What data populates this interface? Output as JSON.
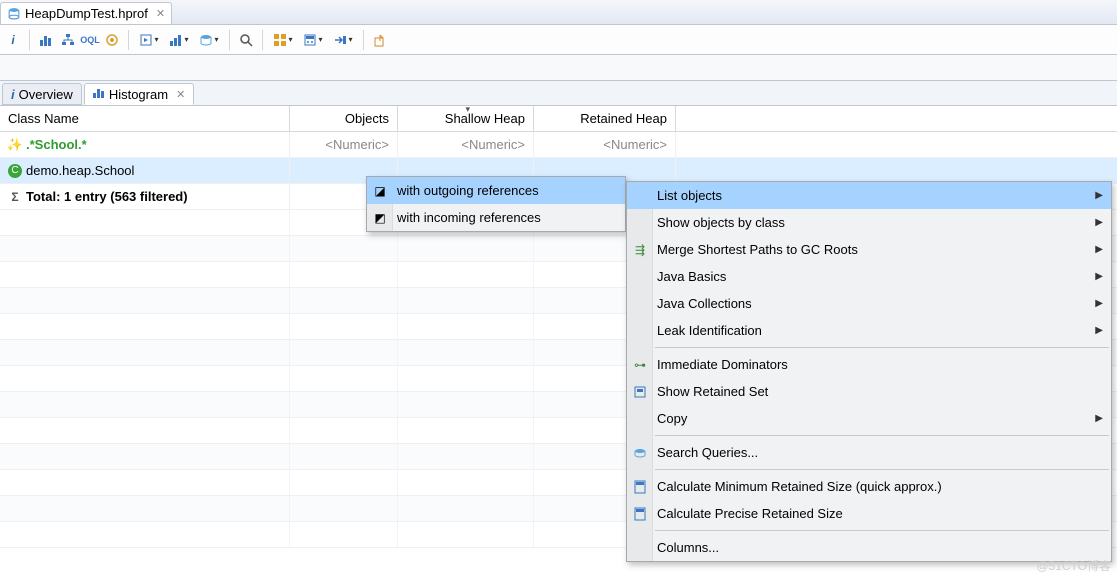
{
  "editorTab": {
    "title": "HeapDumpTest.hprof"
  },
  "viewTabs": {
    "overview": "Overview",
    "histogram": "Histogram"
  },
  "columns": {
    "className": "Class Name",
    "objects": "Objects",
    "shallow": "Shallow Heap",
    "retained": "Retained Heap"
  },
  "filterRow": {
    "pattern": ".*School.*",
    "numeric": "<Numeric>"
  },
  "dataRow": {
    "name": "demo.heap.School"
  },
  "totalRow": {
    "text": "Total: 1 entry (563 filtered)"
  },
  "submenu": {
    "outgoing": "with outgoing references",
    "incoming": "with incoming references"
  },
  "menu": {
    "listObjects": "List objects",
    "showByClass": "Show objects by class",
    "mergePaths": "Merge Shortest Paths to GC Roots",
    "javaBasics": "Java Basics",
    "javaCollections": "Java Collections",
    "leakId": "Leak Identification",
    "immDom": "Immediate Dominators",
    "showRetained": "Show Retained Set",
    "copy": "Copy",
    "searchQueries": "Search Queries...",
    "calcMin": "Calculate Minimum Retained Size (quick approx.)",
    "calcPrecise": "Calculate Precise Retained Size",
    "columns": "Columns..."
  },
  "watermark": "@51CTO博客"
}
